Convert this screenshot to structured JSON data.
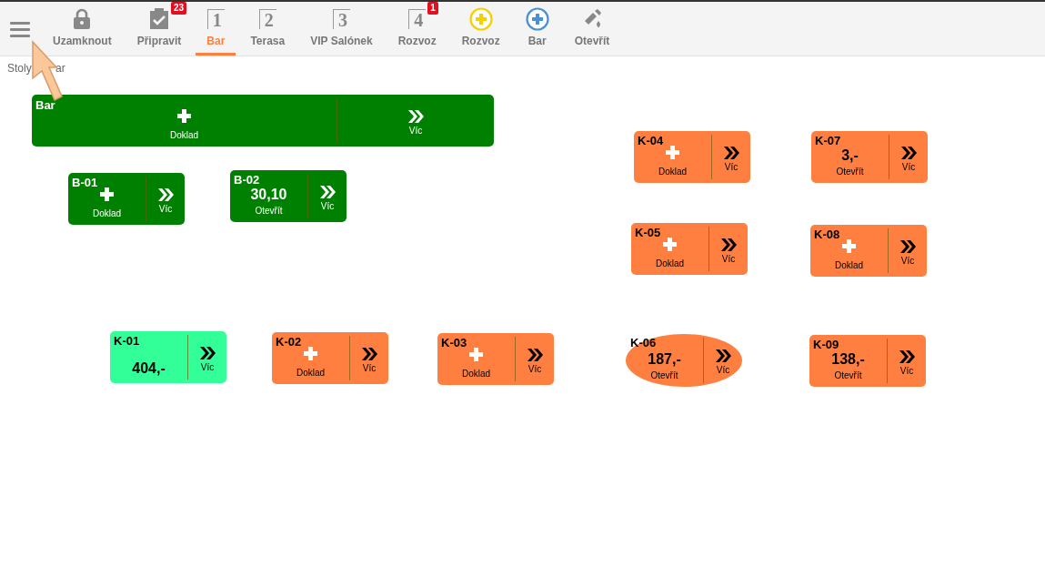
{
  "toolbar": {
    "items": [
      {
        "kind": "menu"
      },
      {
        "kind": "lock",
        "label": "Uzamknout",
        "selected": false
      },
      {
        "kind": "clipboard",
        "label": "Připravit",
        "badge": "23",
        "selected": false
      },
      {
        "kind": "digit",
        "digit": "1",
        "label": "Bar",
        "selected": true
      },
      {
        "kind": "digit",
        "digit": "2",
        "label": "Terasa",
        "selected": false
      },
      {
        "kind": "digit",
        "digit": "3",
        "label": "VIP Salónek",
        "selected": false
      },
      {
        "kind": "digit",
        "digit": "4",
        "label": "Rozvoz",
        "badge": "1",
        "selected": false
      },
      {
        "kind": "plus",
        "color": "#f5d000",
        "label": "Rozvoz",
        "selected": false
      },
      {
        "kind": "plus",
        "color": "#4a90d9",
        "label": "Bar",
        "selected": false
      },
      {
        "kind": "bottle",
        "label": "Otevřít",
        "selected": false
      }
    ]
  },
  "breadcrumb": [
    "Stoly",
    "ar"
  ],
  "tables": [
    {
      "name": "Bar",
      "round": false,
      "color": "#008000",
      "kind": "empty",
      "action_label": "Doklad",
      "more_label": "Víc"
    },
    {
      "name": "B-01",
      "round": false,
      "color": "#008000",
      "kind": "empty",
      "action_label": "Doklad",
      "more_label": "Víc"
    },
    {
      "name": "B-02",
      "round": false,
      "color": "#008000",
      "kind": "open",
      "amount": "30,10",
      "action_label": "Otevřít",
      "more_label": "Víc"
    },
    {
      "name": "K-04",
      "round": false,
      "color": "#ff7f40",
      "kind": "empty",
      "action_label": "Doklad",
      "more_label": "Víc"
    },
    {
      "name": "K-07",
      "round": false,
      "color": "#ff7f40",
      "kind": "open",
      "amount": "3,-",
      "action_label": "Otevřít",
      "more_label": "Víc"
    },
    {
      "name": "K-05",
      "round": false,
      "color": "#ff7f40",
      "kind": "empty",
      "action_label": "Doklad",
      "more_label": "Víc"
    },
    {
      "name": "K-08",
      "round": false,
      "color": "#ff7f40",
      "kind": "empty",
      "action_label": "Doklad",
      "more_label": "Víc"
    },
    {
      "name": "K-01",
      "round": false,
      "color": "#33ff99",
      "kind": "open",
      "amount": "404,-",
      "more_label": "Víc"
    },
    {
      "name": "K-02",
      "round": false,
      "color": "#ff7f40",
      "kind": "empty",
      "action_label": "Doklad",
      "more_label": "Víc"
    },
    {
      "name": "K-03",
      "round": false,
      "color": "#ff7f40",
      "kind": "empty",
      "action_label": "Doklad",
      "more_label": "Víc"
    },
    {
      "name": "K-06",
      "round": true,
      "color": "#ff7f40",
      "kind": "open",
      "amount": "187,-",
      "action_label": "Otevřít",
      "more_label": "Víc"
    },
    {
      "name": "K-09",
      "round": false,
      "color": "#ff7f40",
      "kind": "open",
      "amount": "138,-",
      "action_label": "Otevřít",
      "more_label": "Víc"
    }
  ]
}
